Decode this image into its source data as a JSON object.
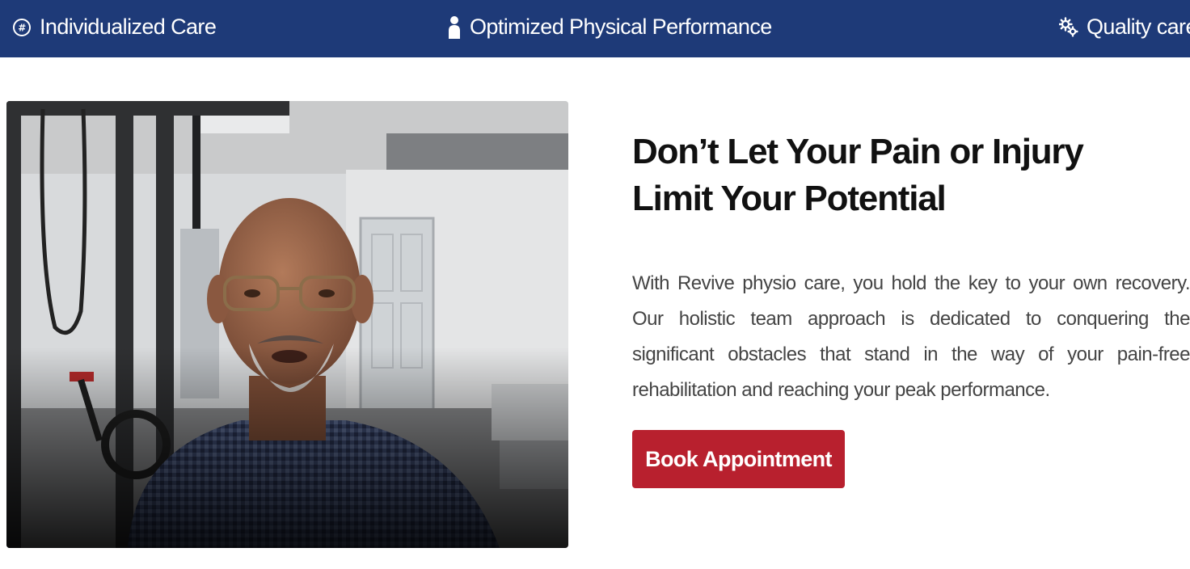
{
  "top_bar": {
    "background": "#1e3a78",
    "features": [
      {
        "icon": "hash-circle-icon",
        "label": "Individualized Care"
      },
      {
        "icon": "person-icon",
        "label": "Optimized Physical Performance"
      },
      {
        "icon": "gears-icon",
        "label": "Quality care"
      }
    ]
  },
  "main": {
    "video": {
      "description_icon": "video-thumbnail"
    },
    "headline": "Don’t Let Your Pain or Injury Limit Your Potential",
    "body": "With Revive physio care, you hold the key to your own recovery. Our holistic team approach is dedicated to conquering the significant obstacles that stand in the way of your pain-free rehabilitation and reaching your peak performance.",
    "cta_label": "Book Appointment",
    "cta_color": "#b8202e"
  }
}
